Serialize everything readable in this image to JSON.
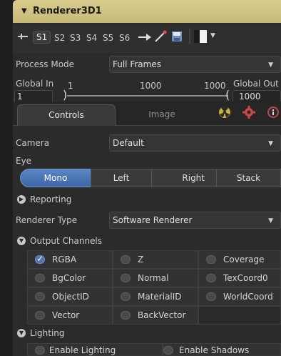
{
  "header": {
    "title": "Renderer3D1"
  },
  "toolbar": {
    "slots": [
      "S1",
      "S2",
      "S3",
      "S4",
      "S5",
      "S6"
    ]
  },
  "process_mode": {
    "label": "Process Mode",
    "value": "Full Frames"
  },
  "global_range": {
    "in_label": "Global In",
    "in_value": "1",
    "out_label": "Global Out",
    "out_value": "1000",
    "tick_start": "1",
    "tick_mid": "1000",
    "tick_end": "1000"
  },
  "tabs": {
    "controls": "Controls",
    "image": "Image"
  },
  "camera": {
    "label": "Camera",
    "value": "Default"
  },
  "eye": {
    "label": "Eye",
    "options": [
      "Mono",
      "Left",
      "Right",
      "Stack"
    ],
    "selected": "Mono"
  },
  "reporting": {
    "label": "Reporting"
  },
  "renderer_type": {
    "label": "Renderer Type",
    "value": "Software Renderer"
  },
  "output_channels": {
    "label": "Output Channels",
    "items": [
      {
        "label": "RGBA",
        "checked": true
      },
      {
        "label": "Z",
        "checked": false
      },
      {
        "label": "Coverage",
        "checked": false
      },
      {
        "label": "BgColor",
        "checked": false
      },
      {
        "label": "Normal",
        "checked": false
      },
      {
        "label": "TexCoord0",
        "checked": false
      },
      {
        "label": "ObjectID",
        "checked": false
      },
      {
        "label": "MaterialID",
        "checked": false
      },
      {
        "label": "WorldCoord",
        "checked": false
      },
      {
        "label": "Vector",
        "checked": false
      },
      {
        "label": "BackVector",
        "checked": false
      }
    ]
  },
  "lighting": {
    "label": "Lighting",
    "enable_lighting": "Enable Lighting",
    "enable_shadows": "Enable Shadows"
  },
  "colors": {
    "accent": "#4f78b9",
    "title_bg": "#d4c786",
    "panel_bg": "#2b2b2b"
  }
}
